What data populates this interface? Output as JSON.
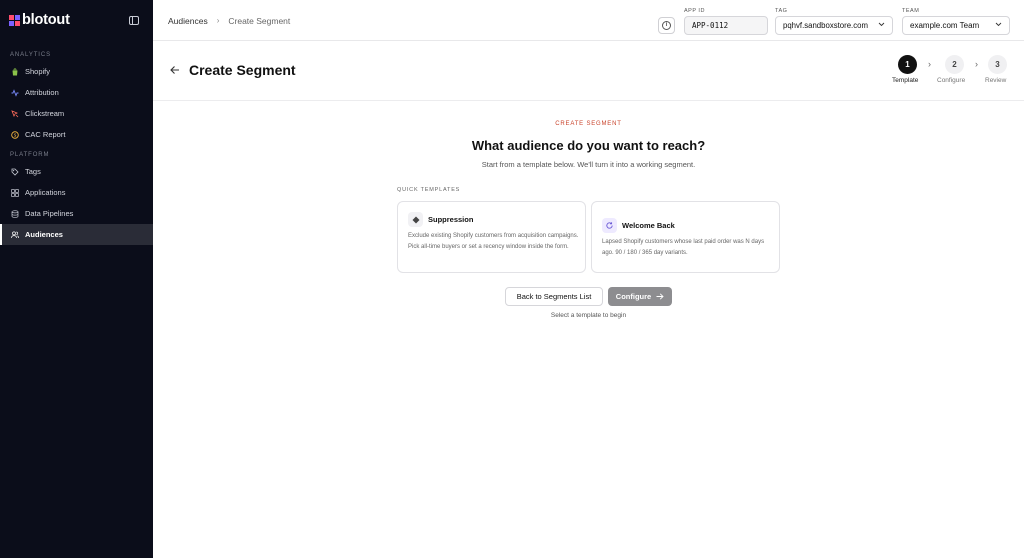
{
  "brand": {
    "name": "blotout"
  },
  "sidebar": {
    "sections": [
      {
        "label": "ANALYTICS",
        "items": [
          {
            "label": "Shopify",
            "icon": "shopify-bag-icon"
          },
          {
            "label": "Attribution",
            "icon": "attribution-icon"
          },
          {
            "label": "Clickstream",
            "icon": "clickstream-icon"
          },
          {
            "label": "CAC Report",
            "icon": "cac-report-icon"
          }
        ]
      },
      {
        "label": "PLATFORM",
        "items": [
          {
            "label": "Tags",
            "icon": "tag-icon"
          },
          {
            "label": "Applications",
            "icon": "applications-icon"
          },
          {
            "label": "Data Pipelines",
            "icon": "database-icon"
          },
          {
            "label": "Audiences",
            "icon": "users-icon",
            "active": true
          }
        ]
      }
    ]
  },
  "topbar": {
    "breadcrumb": [
      "Audiences",
      "Create Segment"
    ],
    "app_id": {
      "label": "APP ID",
      "value": "APP-0112"
    },
    "tag": {
      "label": "TAG",
      "value": "pqhvf.sandboxstore.com"
    },
    "team": {
      "label": "TEAM",
      "value": "example.com Team"
    }
  },
  "page": {
    "title": "Create Segment",
    "steps": [
      {
        "number": "1",
        "label": "Template",
        "active": true
      },
      {
        "number": "2",
        "label": "Configure",
        "active": false
      },
      {
        "number": "3",
        "label": "Review",
        "active": false
      }
    ]
  },
  "main": {
    "eyebrow": "CREATE SEGMENT",
    "headline": "What audience do you want to reach?",
    "subtext": "Start from a template below. We'll turn it into a working segment.",
    "quick_templates_label": "QUICK TEMPLATES",
    "templates": [
      {
        "title": "Suppression",
        "icon": "diamond-icon",
        "description": "Exclude existing Shopify customers from acquisition campaigns. Pick all-time buyers or set a recency window inside the form."
      },
      {
        "title": "Welcome Back",
        "icon": "refresh-icon",
        "description": "Lapsed Shopify customers whose last paid order was N days ago. 90 / 180 / 365 day variants."
      }
    ],
    "back_button": "Back to Segments List",
    "configure_button": "Configure",
    "hint": "Select a template to begin"
  },
  "colors": {
    "sidebar_bg": "#0b0d1a",
    "accent_red": "#c9432b",
    "disabled_button": "#8d8d90"
  }
}
